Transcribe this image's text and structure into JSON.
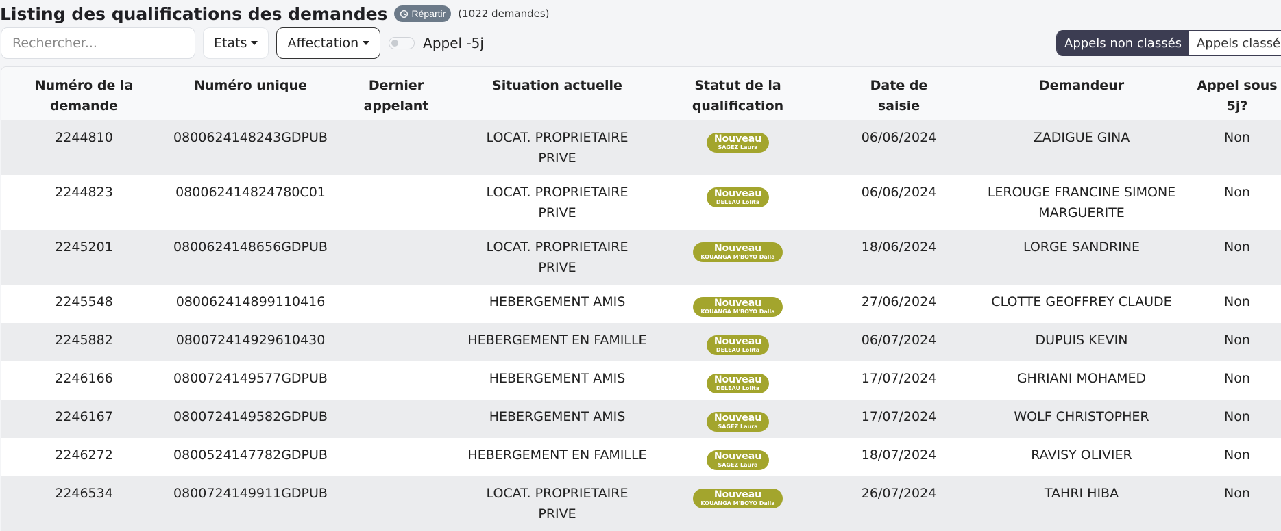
{
  "header": {
    "title": "Listing des qualifications des demandes",
    "repartir_label": "Répartir",
    "count_text": "(1022 demandes)"
  },
  "toolbar": {
    "search_placeholder": "Rechercher...",
    "etats_label": "Etats",
    "affectation_label": "Affectation",
    "appel_toggle_label": "Appel -5j",
    "appel_toggle_on": false,
    "segment": {
      "non_classes": "Appels non classés",
      "classes": "Appels classés",
      "active": "non_classes"
    }
  },
  "colors": {
    "badge": "#a3a52d",
    "segment_active": "#3c3d52",
    "repartir": "#6c7a89"
  },
  "table": {
    "headers": [
      {
        "l1": "Numéro de la",
        "l2": "demande"
      },
      {
        "l1": "Numéro unique",
        "l2": ""
      },
      {
        "l1": "Dernier",
        "l2": "appelant"
      },
      {
        "l1": "Situation actuelle",
        "l2": ""
      },
      {
        "l1": "Statut de la",
        "l2": "qualification"
      },
      {
        "l1": "Date de",
        "l2": "saisie"
      },
      {
        "l1": "Demandeur",
        "l2": ""
      },
      {
        "l1": "Appel sous",
        "l2": "5j?"
      }
    ],
    "rows": [
      {
        "num": "2244810",
        "unique": "0800624148243GDPUB",
        "appelant": "",
        "situation": [
          "LOCAT. PROPRIETAIRE",
          "PRIVE"
        ],
        "status": "Nouveau",
        "agent": "SAGEZ Laura",
        "date": "06/06/2024",
        "demandeur": [
          "ZADIGUE GINA"
        ],
        "appel": "Non"
      },
      {
        "num": "2244823",
        "unique": "080062414824780C01",
        "appelant": "",
        "situation": [
          "LOCAT. PROPRIETAIRE",
          "PRIVE"
        ],
        "status": "Nouveau",
        "agent": "DELEAU Lolita",
        "date": "06/06/2024",
        "demandeur": [
          "LEROUGE FRANCINE SIMONE",
          "MARGUERITE"
        ],
        "appel": "Non"
      },
      {
        "num": "2245201",
        "unique": "0800624148656GDPUB",
        "appelant": "",
        "situation": [
          "LOCAT. PROPRIETAIRE",
          "PRIVE"
        ],
        "status": "Nouveau",
        "agent": "KOUANGA M'BOYO Dalla",
        "date": "18/06/2024",
        "demandeur": [
          "LORGE SANDRINE"
        ],
        "appel": "Non"
      },
      {
        "num": "2245548",
        "unique": "080062414899110416",
        "appelant": "",
        "situation": [
          "HEBERGEMENT AMIS"
        ],
        "status": "Nouveau",
        "agent": "KOUANGA M'BOYO Dalla",
        "date": "27/06/2024",
        "demandeur": [
          "CLOTTE GEOFFREY CLAUDE"
        ],
        "appel": "Non"
      },
      {
        "num": "2245882",
        "unique": "080072414929610430",
        "appelant": "",
        "situation": [
          "HEBERGEMENT EN FAMILLE"
        ],
        "status": "Nouveau",
        "agent": "DELEAU Lolita",
        "date": "06/07/2024",
        "demandeur": [
          "DUPUIS KEVIN"
        ],
        "appel": "Non"
      },
      {
        "num": "2246166",
        "unique": "0800724149577GDPUB",
        "appelant": "",
        "situation": [
          "HEBERGEMENT AMIS"
        ],
        "status": "Nouveau",
        "agent": "DELEAU Lolita",
        "date": "17/07/2024",
        "demandeur": [
          "GHRIANI MOHAMED"
        ],
        "appel": "Non"
      },
      {
        "num": "2246167",
        "unique": "0800724149582GDPUB",
        "appelant": "",
        "situation": [
          "HEBERGEMENT AMIS"
        ],
        "status": "Nouveau",
        "agent": "SAGEZ Laura",
        "date": "17/07/2024",
        "demandeur": [
          "WOLF CHRISTOPHER"
        ],
        "appel": "Non"
      },
      {
        "num": "2246272",
        "unique": "0800524147782GDPUB",
        "appelant": "",
        "situation": [
          "HEBERGEMENT EN FAMILLE"
        ],
        "status": "Nouveau",
        "agent": "SAGEZ Laura",
        "date": "18/07/2024",
        "demandeur": [
          "RAVISY OLIVIER"
        ],
        "appel": "Non"
      },
      {
        "num": "2246534",
        "unique": "0800724149911GDPUB",
        "appelant": "",
        "situation": [
          "LOCAT. PROPRIETAIRE",
          "PRIVE"
        ],
        "status": "Nouveau",
        "agent": "KOUANGA M'BOYO Dalla",
        "date": "26/07/2024",
        "demandeur": [
          "TAHRI HIBA"
        ],
        "appel": "Non"
      }
    ]
  }
}
